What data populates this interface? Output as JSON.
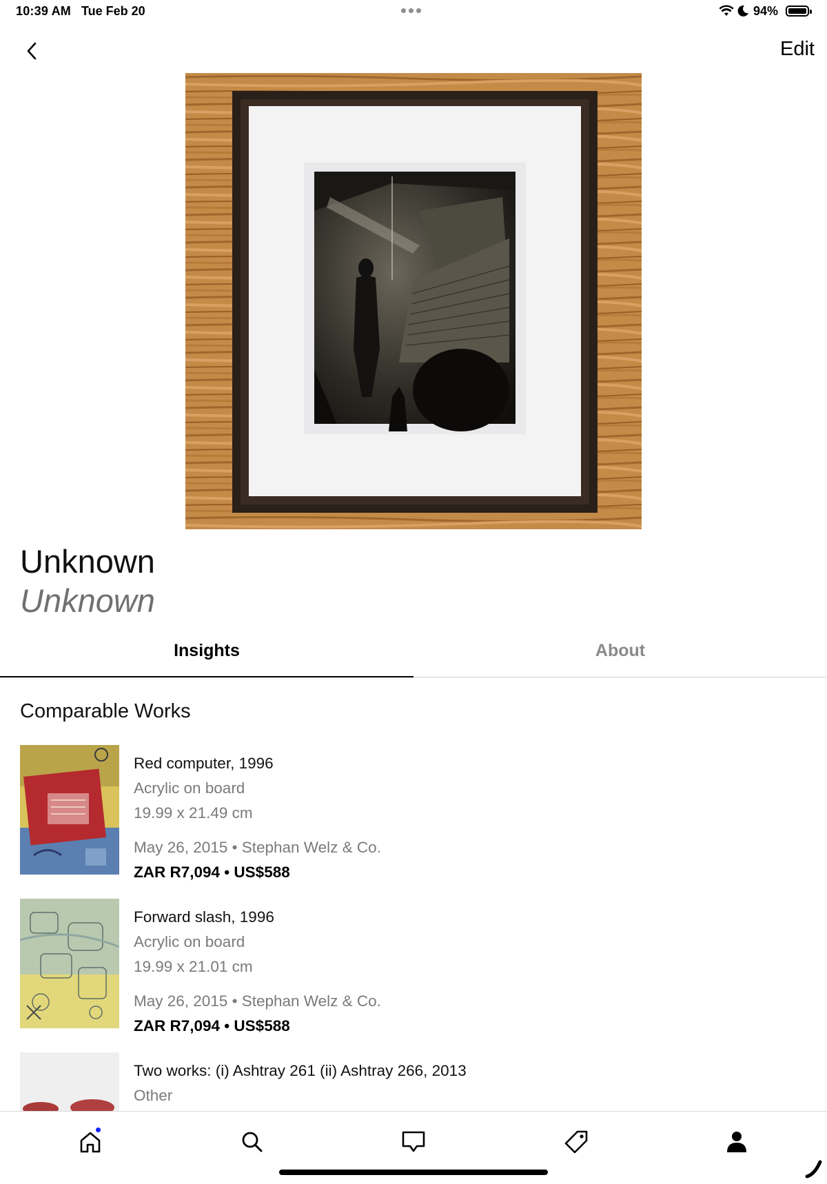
{
  "status_bar": {
    "time": "10:39 AM",
    "date": "Tue Feb 20",
    "battery_percent": "94%",
    "icons": [
      "wifi-icon",
      "moon-icon",
      "battery-icon"
    ]
  },
  "nav": {
    "edit_label": "Edit",
    "back_icon": "chevron-left-icon"
  },
  "artwork": {
    "artist": "Unknown",
    "title": "Unknown"
  },
  "tabs": [
    {
      "label": "Insights",
      "active": true
    },
    {
      "label": "About",
      "active": false
    }
  ],
  "comparable": {
    "heading": "Comparable Works",
    "items": [
      {
        "title": "Red computer, 1996",
        "medium": "Acrylic on board",
        "dimensions": "19.99 x 21.49 cm",
        "sale": "May 26, 2015 • Stephan Welz & Co.",
        "price": "ZAR R7,094 • US$588"
      },
      {
        "title": "Forward slash, 1996",
        "medium": "Acrylic on board",
        "dimensions": "19.99 x 21.01 cm",
        "sale": "May 26, 2015 • Stephan Welz & Co.",
        "price": "ZAR R7,094 • US$588"
      },
      {
        "title": "Two works: (i) Ashtray 261 (ii) Ashtray 266, 2013",
        "medium": "Other"
      }
    ]
  },
  "bottom_nav": {
    "items": [
      "home-icon",
      "search-icon",
      "inbox-icon",
      "sell-tag-icon",
      "profile-icon"
    ]
  },
  "colors": {
    "accent_dot": "#1023ff",
    "secondary_text": "#7a7a7a"
  }
}
